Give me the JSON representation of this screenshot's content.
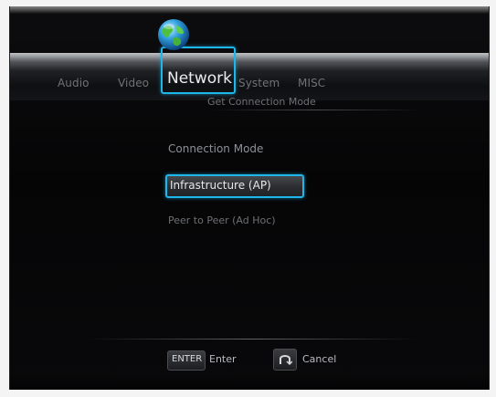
{
  "menu": {
    "tabs": [
      {
        "label": "Audio"
      },
      {
        "label": "Video"
      },
      {
        "label": "Network"
      },
      {
        "label": "System"
      },
      {
        "label": "MISC"
      }
    ],
    "active_tab": "Network",
    "active_icon": "globe-icon"
  },
  "page": {
    "subtitle": "Get Connection Mode",
    "section_label": "Connection Mode",
    "options": [
      {
        "label": "Infrastructure (AP)",
        "selected": true
      },
      {
        "label": "Peer to Peer (Ad Hoc)",
        "selected": false
      }
    ]
  },
  "footer": {
    "enter_key": "ENTER",
    "enter_label": "Enter",
    "cancel_icon": "return-icon",
    "cancel_label": "Cancel"
  },
  "colors": {
    "accent": "#1fb6ea",
    "background": "#050506"
  }
}
